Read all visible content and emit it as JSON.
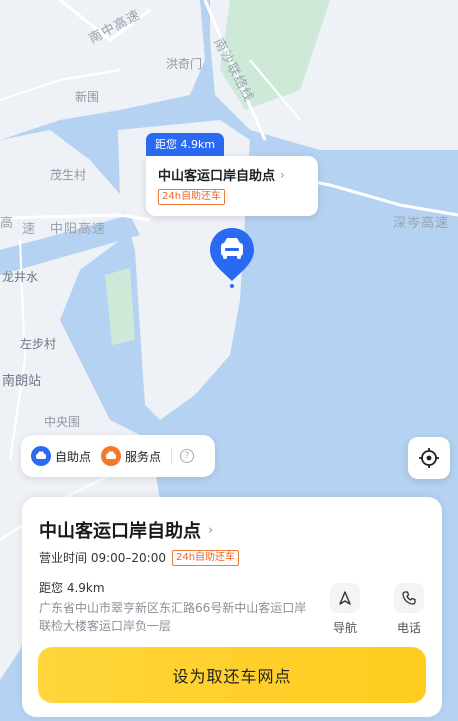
{
  "map": {
    "labels": {
      "nanzhong_highway": "南中高速",
      "hongqimen": "洪奇门",
      "nansha_port": "南沙联络线",
      "xinwei": "新围",
      "maosheng_village": "茂生村",
      "zhongyang_highway": "中阳高速",
      "gao": "高",
      "su": "速",
      "longjingshui": "龙井水",
      "zuobu_village": "左步村",
      "nanlang_station": "南朗站",
      "zhongyangwei": "中央围",
      "shencen_highway": "深岑高速"
    },
    "water_color": "#b5d2f2",
    "land_color": "#eef1f6",
    "green_color": "#cfe9d9"
  },
  "marker": {
    "distance_tag": "距您 4.9km",
    "title": "中山客运口岸自助点",
    "tag": "24h自助还车",
    "accent": "#2a6af2"
  },
  "legend": {
    "self_service": "自助点",
    "service_point": "服务点",
    "help": "?"
  },
  "card": {
    "title": "中山客运口岸自助点",
    "hours": "营业时间 09:00–20:00",
    "tag": "24h自助还车",
    "distance": "距您 4.9km",
    "address": "广东省中山市翠亨新区东汇路66号新中山客运口岸联检大楼客运口岸负一层",
    "nav_label": "导航",
    "phone_label": "电话",
    "primary_button": "设为取还车网点"
  },
  "icons": {
    "chevron": "›",
    "locate": "locate-icon",
    "nav": "navigation-arrow-icon",
    "phone": "phone-icon",
    "car": "car-icon"
  }
}
